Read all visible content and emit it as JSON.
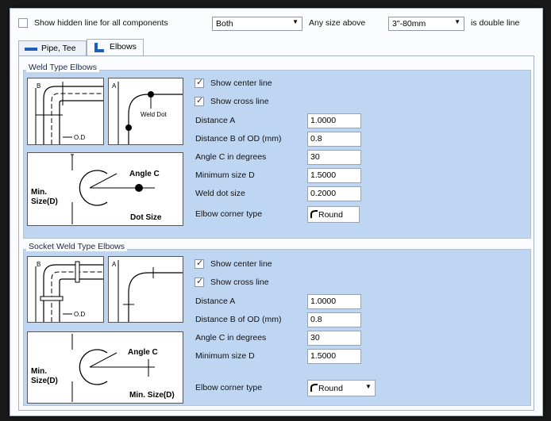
{
  "top": {
    "show_hidden_label": "Show hidden line for all components",
    "show_hidden_checked": false,
    "mode_value": "Both",
    "any_size_label": "Any size above",
    "size_value": "3\"-80mm",
    "double_line_label": "is double line"
  },
  "tabs": [
    {
      "label": "Pipe, Tee",
      "icon": "pipe-icon",
      "active": false
    },
    {
      "label": "Elbows",
      "icon": "elbow-icon",
      "active": true
    }
  ],
  "weld": {
    "title": "Weld Type Elbows",
    "show_center_line": "Show center line",
    "show_cross_line": "Show cross line",
    "fields": [
      {
        "label": "Distance A",
        "value": "1.0000"
      },
      {
        "label": "Distance B of OD (mm)",
        "value": "0.8"
      },
      {
        "label": "Angle C in degrees",
        "value": "30"
      },
      {
        "label": "Minimum size D",
        "value": "1.5000"
      },
      {
        "label": "Weld dot size",
        "value": "0.2000"
      }
    ],
    "corner_label": "Elbow corner type",
    "corner_value": "Round",
    "diagram": {
      "b": "B",
      "od": "O.D",
      "a": "A",
      "weld_dot": "Weld Dot",
      "min_size_1": "Min.",
      "min_size_2": "Size(D)",
      "angle_c": "Angle C",
      "dot_size": "Dot Size"
    }
  },
  "socket": {
    "title": "Socket Weld Type Elbows",
    "show_center_line": "Show center line",
    "show_cross_line": "Show cross line",
    "fields": [
      {
        "label": "Distance A",
        "value": "1.0000"
      },
      {
        "label": "Distance B of OD (mm)",
        "value": "0.8"
      },
      {
        "label": "Angle C in degrees",
        "value": "30"
      },
      {
        "label": "Minimum size D",
        "value": "1.5000"
      }
    ],
    "corner_label": "Elbow corner type",
    "corner_value": "Round",
    "diagram": {
      "b": "B",
      "od": "O.D",
      "a": "A",
      "min_size_1": "Min.",
      "min_size_2": "Size(D)",
      "angle_c": "Angle C",
      "min_size_d": "Min. Size(D)"
    }
  }
}
